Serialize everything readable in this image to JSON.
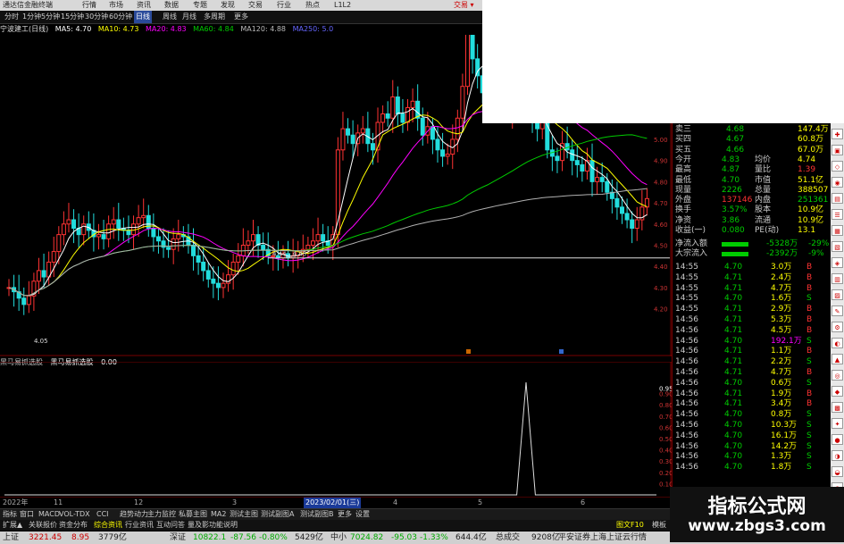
{
  "titlebar": {
    "app": "通达信金融终端",
    "menus": [
      "行情",
      "市场",
      "资讯",
      "数据",
      "专题",
      "发现",
      "交易",
      "行业",
      "热点",
      "L1L2"
    ],
    "trade": "交易 ▾"
  },
  "toolbar": {
    "periods": [
      "分时",
      "1分钟",
      "5分钟",
      "15分钟",
      "30分钟",
      "60分钟",
      "日线",
      "周线",
      "月线",
      "多周期",
      "更多"
    ],
    "selected": "日线"
  },
  "ma_legend": {
    "stock": "宁波建工(日线)",
    "ma5": "MA5: 4.70",
    "ma10": "MA10: 4.73",
    "ma20": "MA20: 4.83",
    "ma60": "MA60: 4.84",
    "ma120": "MA120: 4.88",
    "extra": "MA250: 5.0"
  },
  "price_axis": [
    "5.30",
    "5.20",
    "5.10",
    "5.00",
    "4.90",
    "4.80",
    "4.70",
    "4.60",
    "4.50",
    "4.40",
    "4.30",
    "4.20"
  ],
  "annotations": {
    "low": "4.05",
    "hline": "4.44 - 4.45"
  },
  "indicator": {
    "title": "黑马易抓选股",
    "name": "黑马易抓选股",
    "value": "0.00",
    "axis": [
      "0.95",
      "0.90",
      "0.80",
      "0.70",
      "0.60",
      "0.50",
      "0.40",
      "0.30",
      "0.20",
      "0.10"
    ]
  },
  "chart_data": [
    {
      "type": "candlestick",
      "title": "宁波建工(日线)",
      "ylim": [
        4.0,
        5.35
      ],
      "series": [
        {
          "name": "MA5"
        },
        {
          "name": "MA10"
        },
        {
          "name": "MA20"
        },
        {
          "name": "MA60"
        },
        {
          "name": "MA120"
        }
      ],
      "closes": [
        4.3,
        4.28,
        4.25,
        4.22,
        4.26,
        4.33,
        4.38,
        4.35,
        4.42,
        4.47,
        4.55,
        4.6,
        4.62,
        4.58,
        4.55,
        4.6,
        4.57,
        4.54,
        4.55,
        4.53,
        4.6,
        4.62,
        4.58,
        4.57,
        4.55,
        4.6,
        4.63,
        4.64,
        4.58,
        4.54,
        4.52,
        4.49,
        4.48,
        4.53,
        4.55,
        4.54,
        4.5,
        4.45,
        4.42,
        4.38,
        4.34,
        4.32,
        4.3,
        4.32,
        4.36,
        4.42,
        4.45,
        4.5,
        4.52,
        4.55,
        4.5,
        4.48,
        4.45,
        4.45,
        4.44,
        4.46,
        4.44,
        4.45,
        4.47,
        4.48,
        4.5,
        4.52,
        4.55,
        4.52,
        4.5,
        4.55,
        4.95,
        5.05,
        5.02,
        4.98,
        5.03,
        5.05,
        4.98,
        4.95,
        5.08,
        5.12,
        5.1,
        5.2,
        5.12,
        5.08,
        5.15,
        5.18,
        5.1,
        5.02,
        5.06,
        5.0,
        4.95,
        4.92,
        4.93,
        5.0,
        5.1,
        5.25,
        5.58,
        5.38,
        5.3,
        5.22,
        5.15,
        5.22,
        5.2,
        5.18,
        5.12,
        5.15,
        5.18,
        5.2,
        5.15,
        5.1,
        5.05,
        5.08,
        4.95,
        4.92,
        4.9,
        4.98,
        4.95,
        4.9,
        4.88,
        4.85,
        4.9,
        4.8,
        4.82,
        4.8,
        4.75,
        4.72,
        4.68,
        4.65,
        4.62,
        4.58,
        4.62,
        4.68,
        4.72
      ]
    },
    {
      "type": "line",
      "title": "黑马易抓选股",
      "ylim": [
        0,
        1
      ],
      "x": [
        0,
        1,
        2,
        3,
        4,
        5,
        6,
        7,
        8,
        9,
        10,
        11,
        12,
        13,
        14,
        15,
        16,
        17,
        18,
        19,
        20,
        21,
        22,
        23,
        24,
        25,
        26,
        27,
        28,
        29,
        30,
        31,
        32,
        33,
        34,
        35,
        36,
        37,
        38,
        39,
        40,
        41,
        42,
        43,
        44,
        45,
        46,
        47,
        48,
        49,
        50,
        51,
        52,
        53,
        54,
        55,
        56,
        57,
        58,
        59,
        60,
        61,
        62,
        63,
        64,
        65,
        66,
        67,
        68,
        69,
        70
      ],
      "values": [
        0,
        0,
        0,
        0,
        0,
        0,
        0,
        0,
        0,
        0,
        0,
        0,
        0,
        0,
        0,
        0,
        0,
        0,
        0,
        0,
        0,
        0,
        0,
        0,
        0,
        0,
        0,
        0,
        0,
        0,
        0,
        0,
        0,
        0,
        0,
        0,
        0,
        0,
        0,
        0,
        0,
        0,
        0,
        0,
        0,
        0,
        0,
        0,
        0,
        0,
        0,
        0,
        0,
        0,
        0,
        0,
        1,
        0,
        0,
        0,
        0,
        0,
        0,
        0,
        0,
        0,
        0,
        0,
        0,
        0,
        0
      ]
    }
  ],
  "datebar": {
    "labels": [
      "2022年",
      "11",
      "12",
      "3",
      "2023/02/01(三)",
      "4",
      "5",
      "6"
    ],
    "selected": "2023/02/01(三)"
  },
  "tabs": [
    "指标",
    "窗口",
    "MACD",
    "VOL-TDX",
    "CCI",
    "趋势动力",
    "主力监控",
    "私募主图",
    "MA2",
    "测试主图",
    "测试副图A",
    "测试副图B",
    "更多",
    "设置"
  ],
  "tabs2": [
    "扩展▲",
    "关联报价",
    "资金分布",
    "综合资讯",
    "行业资讯",
    "互动问答",
    "量及影功能说明"
  ],
  "tabs2_right": [
    "图文F10",
    "模板"
  ],
  "quote": {
    "rows": [
      {
        "label": "卖三",
        "price": "4.68",
        "vol": "147.4万"
      },
      {
        "label": "买四",
        "price": "4.67",
        "vol": "60.8万"
      },
      {
        "label": "买五",
        "price": "4.66",
        "vol": "67.0万"
      },
      {
        "label": "今开",
        "val1": "4.83",
        "label2": "均价",
        "val2": "4.74"
      },
      {
        "label": "最高",
        "val1": "4.87",
        "label2": "量比",
        "val2": "1.39"
      },
      {
        "label": "最低",
        "val1": "4.70",
        "label2": "市值",
        "val2": "51.1亿"
      },
      {
        "label": "现量",
        "val1": "2226",
        "label2": "总量",
        "val2": "388507"
      },
      {
        "label": "外盘",
        "val1": "137146",
        "label2": "内盘",
        "val2": "251361"
      },
      {
        "label": "换手",
        "val1": "3.57%",
        "label2": "股本",
        "val2": "10.9亿"
      },
      {
        "label": "净资",
        "val1": "3.86",
        "label2": "流通",
        "val2": "10.9亿"
      },
      {
        "label": "收益(一)",
        "val1": "0.080",
        "label2": "PE(动)",
        "val2": "13.1"
      }
    ],
    "flows": [
      {
        "label": "净流入额",
        "value": "-5328万",
        "pct": "-29%"
      },
      {
        "label": "大宗流入",
        "value": "-2392万",
        "pct": "-9%"
      }
    ]
  },
  "trades": [
    {
      "time": "14:55",
      "price": "4.70",
      "vol": "3.0万",
      "side": "B"
    },
    {
      "time": "14:55",
      "price": "4.71",
      "vol": "2.4万",
      "side": "B"
    },
    {
      "time": "14:55",
      "price": "4.71",
      "vol": "4.7万",
      "side": "B"
    },
    {
      "time": "14:55",
      "price": "4.70",
      "vol": "1.6万",
      "side": "S"
    },
    {
      "time": "14:55",
      "price": "4.71",
      "vol": "2.9万",
      "side": "B"
    },
    {
      "time": "14:56",
      "price": "4.71",
      "vol": "5.3万",
      "side": "B"
    },
    {
      "time": "14:56",
      "price": "4.71",
      "vol": "4.5万",
      "side": "B"
    },
    {
      "time": "14:56",
      "price": "4.70",
      "vol": "192.1万",
      "side": "S"
    },
    {
      "time": "14:56",
      "price": "4.71",
      "vol": "1.1万",
      "side": "B"
    },
    {
      "time": "14:56",
      "price": "4.71",
      "vol": "2.2万",
      "side": "S"
    },
    {
      "time": "14:56",
      "price": "4.71",
      "vol": "4.7万",
      "side": "B"
    },
    {
      "time": "14:56",
      "price": "4.70",
      "vol": "0.6万",
      "side": "S"
    },
    {
      "time": "14:56",
      "price": "4.71",
      "vol": "1.9万",
      "side": "B"
    },
    {
      "time": "14:56",
      "price": "4.71",
      "vol": "3.4万",
      "side": "B"
    },
    {
      "time": "14:56",
      "price": "4.70",
      "vol": "0.8万",
      "side": "S"
    },
    {
      "time": "14:56",
      "price": "4.70",
      "vol": "10.3万",
      "side": "S"
    },
    {
      "time": "14:56",
      "price": "4.70",
      "vol": "16.1万",
      "side": "S"
    },
    {
      "time": "14:56",
      "price": "4.70",
      "vol": "14.2万",
      "side": "S"
    },
    {
      "time": "14:56",
      "price": "4.70",
      "vol": "1.3万",
      "side": "S"
    },
    {
      "time": "14:56",
      "price": "4.70",
      "vol": "1.8万",
      "side": "S"
    }
  ],
  "statusbar": {
    "items": [
      "上证",
      "3221.45",
      "8.95",
      "3779亿",
      "深证",
      "10822.1",
      "-87.56",
      "-0.80%",
      "5429亿",
      "中小",
      "7024.82",
      "-95.03",
      "-1.33%",
      "644.4亿",
      "总成交",
      "9208亿",
      "平安证券上海上证云行情"
    ]
  },
  "watermark": {
    "line1": "指标公式网",
    "line2": "www.zbgs3.com"
  },
  "colors": {
    "up": "#ff3333",
    "down": "#22dddd",
    "ma5": "#ffffff",
    "ma10": "#ffff00",
    "ma20": "#ff00ff",
    "ma60": "#00cc00",
    "ma120": "#b0b0b0"
  }
}
